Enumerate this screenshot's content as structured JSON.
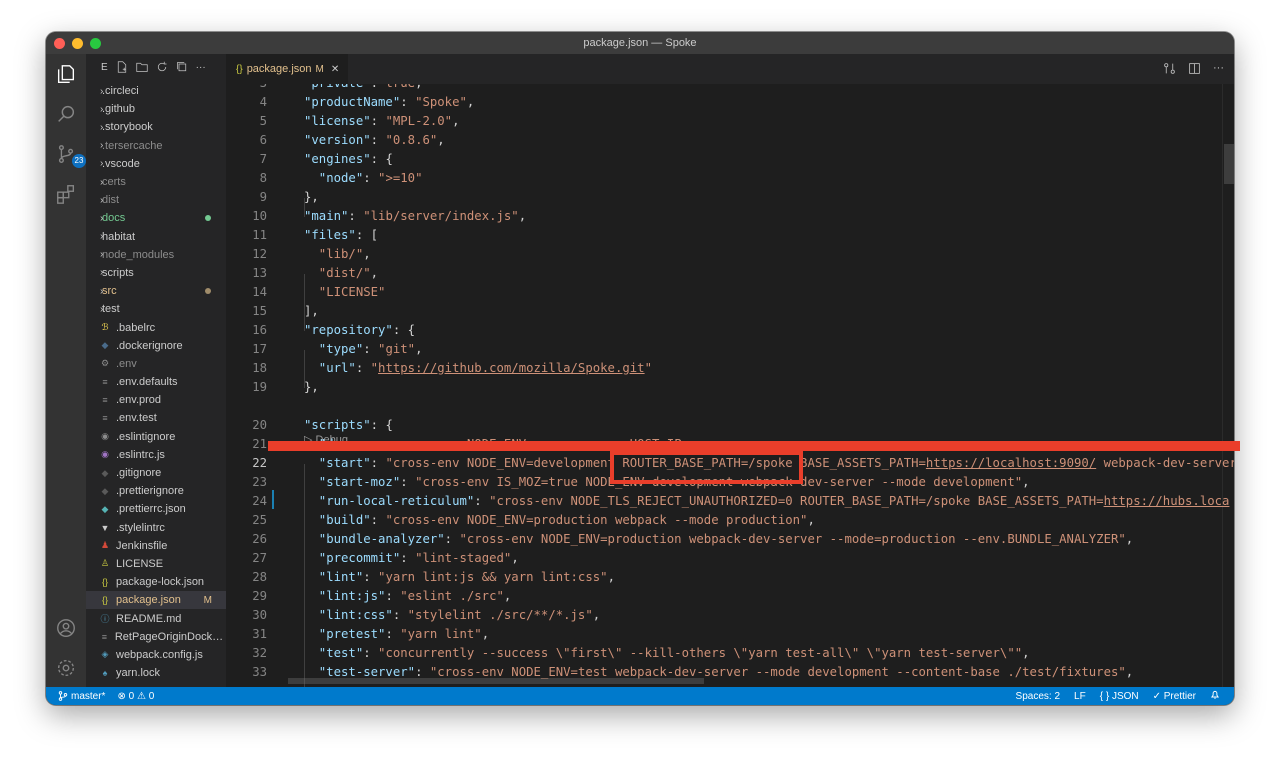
{
  "window": {
    "title": "package.json — Spoke"
  },
  "activity": {
    "scm_badge": "23"
  },
  "sidebar": {
    "header_letter": "E",
    "items": [
      {
        "label": ".circleci",
        "type": "folder",
        "color": "#cccccc"
      },
      {
        "label": ".github",
        "type": "folder",
        "color": "#cccccc"
      },
      {
        "label": ".storybook",
        "type": "folder",
        "color": "#cccccc"
      },
      {
        "label": ".tersercache",
        "type": "folder",
        "color": "#8c8c8c"
      },
      {
        "label": ".vscode",
        "type": "folder",
        "color": "#cccccc"
      },
      {
        "label": "certs",
        "type": "folder",
        "color": "#8c8c8c"
      },
      {
        "label": "dist",
        "type": "folder",
        "color": "#8c8c8c"
      },
      {
        "label": "docs",
        "type": "folder",
        "color": "#73c991",
        "dot": "#73c991"
      },
      {
        "label": "habitat",
        "type": "folder",
        "color": "#cccccc"
      },
      {
        "label": "node_modules",
        "type": "folder",
        "color": "#8c8c8c"
      },
      {
        "label": "scripts",
        "type": "folder",
        "color": "#cccccc"
      },
      {
        "label": "src",
        "type": "folder",
        "color": "#e2c08d",
        "dot": "#a08c6a"
      },
      {
        "label": "test",
        "type": "folder",
        "color": "#cccccc"
      },
      {
        "label": ".babelrc",
        "type": "file",
        "icon": "babel-icon",
        "icon_glyph": "ℬ",
        "icon_color": "#f5da55",
        "color": "#cccccc"
      },
      {
        "label": ".dockerignore",
        "type": "file",
        "icon": "docker-icon",
        "icon_glyph": "◆",
        "icon_color": "#4a6b8a",
        "color": "#cccccc"
      },
      {
        "label": ".env",
        "type": "file",
        "icon": "gear-icon",
        "icon_glyph": "⚙",
        "icon_color": "#8c8c8c",
        "color": "#8c8c8c"
      },
      {
        "label": ".env.defaults",
        "type": "file",
        "icon": "lines-icon",
        "icon_glyph": "≡",
        "icon_color": "#8c8c8c",
        "color": "#cccccc"
      },
      {
        "label": ".env.prod",
        "type": "file",
        "icon": "lines-icon",
        "icon_glyph": "≡",
        "icon_color": "#8c8c8c",
        "color": "#cccccc"
      },
      {
        "label": ".env.test",
        "type": "file",
        "icon": "lines-icon",
        "icon_glyph": "≡",
        "icon_color": "#8c8c8c",
        "color": "#cccccc"
      },
      {
        "label": ".eslintignore",
        "type": "file",
        "icon": "eslint-icon",
        "icon_glyph": "◉",
        "icon_color": "#8c8c8c",
        "color": "#cccccc"
      },
      {
        "label": ".eslintrc.js",
        "type": "file",
        "icon": "eslint-icon",
        "icon_glyph": "◉",
        "icon_color": "#a074c4",
        "color": "#cccccc"
      },
      {
        "label": ".gitignore",
        "type": "file",
        "icon": "git-icon",
        "icon_glyph": "◆",
        "icon_color": "#5a5a5a",
        "color": "#cccccc"
      },
      {
        "label": ".prettierignore",
        "type": "file",
        "icon": "prettier-icon",
        "icon_glyph": "◆",
        "icon_color": "#5a5a5a",
        "color": "#cccccc"
      },
      {
        "label": ".prettierrc.json",
        "type": "file",
        "icon": "prettier-icon",
        "icon_glyph": "◆",
        "icon_color": "#56b3b4",
        "color": "#cccccc"
      },
      {
        "label": ".stylelintrc",
        "type": "file",
        "icon": "stylelint-icon",
        "icon_glyph": "▼",
        "icon_color": "#cccccc",
        "color": "#cccccc"
      },
      {
        "label": "Jenkinsfile",
        "type": "file",
        "icon": "jenkins-icon",
        "icon_glyph": "♟",
        "icon_color": "#d24939",
        "color": "#cccccc"
      },
      {
        "label": "LICENSE",
        "type": "file",
        "icon": "license-icon",
        "icon_glyph": "♙",
        "icon_color": "#cbcb41",
        "color": "#cccccc"
      },
      {
        "label": "package-lock.json",
        "type": "file",
        "icon": "json-icon",
        "icon_glyph": "{}",
        "icon_color": "#cbcb41",
        "color": "#cccccc"
      },
      {
        "label": "package.json",
        "type": "file",
        "icon": "json-icon",
        "icon_glyph": "{}",
        "icon_color": "#cbcb41",
        "color": "#e2c08d",
        "selected": true,
        "mod": "M"
      },
      {
        "label": "README.md",
        "type": "file",
        "icon": "info-icon",
        "icon_glyph": "ⓘ",
        "icon_color": "#519aba",
        "color": "#cccccc"
      },
      {
        "label": "RetPageOriginDockerfile",
        "type": "file",
        "icon": "lines-icon",
        "icon_glyph": "≡",
        "icon_color": "#8c8c8c",
        "color": "#cccccc"
      },
      {
        "label": "webpack.config.js",
        "type": "file",
        "icon": "webpack-icon",
        "icon_glyph": "◈",
        "icon_color": "#519aba",
        "color": "#cccccc"
      },
      {
        "label": "yarn.lock",
        "type": "file",
        "icon": "yarn-icon",
        "icon_glyph": "♠",
        "icon_color": "#519aba",
        "color": "#cccccc"
      }
    ]
  },
  "tab": {
    "icon": "{}",
    "label": "package.json",
    "modified": "M",
    "close": "✕"
  },
  "codelens": "▷ Debug",
  "lines": [
    {
      "n": "3",
      "tokens": [
        {
          "t": "\"private\"",
          "c": "k"
        },
        {
          "t": ": ",
          "c": "p"
        },
        {
          "t": "true",
          "c": "s"
        },
        {
          "t": ",",
          "c": "p"
        }
      ]
    },
    {
      "n": "4",
      "tokens": [
        {
          "t": "\"productName\"",
          "c": "k"
        },
        {
          "t": ": ",
          "c": "p"
        },
        {
          "t": "\"Spoke\"",
          "c": "s"
        },
        {
          "t": ",",
          "c": "p"
        }
      ]
    },
    {
      "n": "5",
      "tokens": [
        {
          "t": "\"license\"",
          "c": "k"
        },
        {
          "t": ": ",
          "c": "p"
        },
        {
          "t": "\"MPL-2.0\"",
          "c": "s"
        },
        {
          "t": ",",
          "c": "p"
        }
      ]
    },
    {
      "n": "6",
      "tokens": [
        {
          "t": "\"version\"",
          "c": "k"
        },
        {
          "t": ": ",
          "c": "p"
        },
        {
          "t": "\"0.8.6\"",
          "c": "s"
        },
        {
          "t": ",",
          "c": "p"
        }
      ]
    },
    {
      "n": "7",
      "tokens": [
        {
          "t": "\"engines\"",
          "c": "k"
        },
        {
          "t": ": {",
          "c": "p"
        }
      ]
    },
    {
      "n": "8",
      "tokens": [
        {
          "t": "  \"node\"",
          "c": "k"
        },
        {
          "t": ": ",
          "c": "p"
        },
        {
          "t": "\">=10\"",
          "c": "s"
        }
      ]
    },
    {
      "n": "9",
      "tokens": [
        {
          "t": "},",
          "c": "p"
        }
      ]
    },
    {
      "n": "10",
      "tokens": [
        {
          "t": "\"main\"",
          "c": "k"
        },
        {
          "t": ": ",
          "c": "p"
        },
        {
          "t": "\"lib/server/index.js\"",
          "c": "s"
        },
        {
          "t": ",",
          "c": "p"
        }
      ]
    },
    {
      "n": "11",
      "tokens": [
        {
          "t": "\"files\"",
          "c": "k"
        },
        {
          "t": ": [",
          "c": "p"
        }
      ]
    },
    {
      "n": "12",
      "tokens": [
        {
          "t": "  \"lib/\"",
          "c": "s"
        },
        {
          "t": ",",
          "c": "p"
        }
      ]
    },
    {
      "n": "13",
      "tokens": [
        {
          "t": "  \"dist/\"",
          "c": "s"
        },
        {
          "t": ",",
          "c": "p"
        }
      ]
    },
    {
      "n": "14",
      "tokens": [
        {
          "t": "  \"LICENSE\"",
          "c": "s"
        }
      ]
    },
    {
      "n": "15",
      "tokens": [
        {
          "t": "],",
          "c": "p"
        }
      ]
    },
    {
      "n": "16",
      "tokens": [
        {
          "t": "\"repository\"",
          "c": "k"
        },
        {
          "t": ": {",
          "c": "p"
        }
      ]
    },
    {
      "n": "17",
      "tokens": [
        {
          "t": "  \"type\"",
          "c": "k"
        },
        {
          "t": ": ",
          "c": "p"
        },
        {
          "t": "\"git\"",
          "c": "s"
        },
        {
          "t": ",",
          "c": "p"
        }
      ]
    },
    {
      "n": "18",
      "tokens": [
        {
          "t": "  \"url\"",
          "c": "k"
        },
        {
          "t": ": ",
          "c": "p"
        },
        {
          "t": "\"",
          "c": "s"
        },
        {
          "t": "https://github.com/mozilla/Spoke.git",
          "c": "u"
        },
        {
          "t": "\"",
          "c": "s"
        }
      ]
    },
    {
      "n": "19",
      "tokens": [
        {
          "t": "},",
          "c": "p"
        }
      ]
    },
    {
      "n": "20",
      "tokens": [
        {
          "t": "\"scripts\"",
          "c": "k"
        },
        {
          "t": ": {",
          "c": "p"
        }
      ]
    },
    {
      "n": "21",
      "tokens": [
        {
          "t": "  \"d",
          "c": "k"
        },
        {
          "t": "   ",
          "c": "p"
        },
        {
          "t": "               NODE_ENV=             HOST_IP=           ",
          "c": "s"
        }
      ]
    },
    {
      "n": "22",
      "current": true,
      "tokens": [
        {
          "t": "  \"start\"",
          "c": "k"
        },
        {
          "t": ": ",
          "c": "p"
        },
        {
          "t": "\"cross-env NODE_ENV=development ROUTER_BASE_PATH=/spoke BASE_ASSETS_PATH=",
          "c": "s"
        },
        {
          "t": "https://localhost:9090/",
          "c": "u"
        },
        {
          "t": " webpack-dev-server",
          "c": "s"
        }
      ]
    },
    {
      "n": "23",
      "tokens": [
        {
          "t": "  \"start-moz\"",
          "c": "k"
        },
        {
          "t": ": ",
          "c": "p"
        },
        {
          "t": "\"cross-env IS_MOZ=true NODE_ENV=development webpack-dev-server --mode development\"",
          "c": "s"
        },
        {
          "t": ",",
          "c": "p"
        }
      ]
    },
    {
      "n": "24",
      "tokens": [
        {
          "t": "  \"run-local-reticulum\"",
          "c": "k"
        },
        {
          "t": ": ",
          "c": "p"
        },
        {
          "t": "\"cross-env NODE_TLS_REJECT_UNAUTHORIZED=0 ROUTER_BASE_PATH=/spoke BASE_ASSETS_PATH=",
          "c": "s"
        },
        {
          "t": "https://hubs.loca",
          "c": "u"
        }
      ]
    },
    {
      "n": "25",
      "tokens": [
        {
          "t": "  \"build\"",
          "c": "k"
        },
        {
          "t": ": ",
          "c": "p"
        },
        {
          "t": "\"cross-env NODE_ENV=production webpack --mode production\"",
          "c": "s"
        },
        {
          "t": ",",
          "c": "p"
        }
      ]
    },
    {
      "n": "26",
      "tokens": [
        {
          "t": "  \"bundle-analyzer\"",
          "c": "k"
        },
        {
          "t": ": ",
          "c": "p"
        },
        {
          "t": "\"cross-env NODE_ENV=production webpack-dev-server --mode=production --env.BUNDLE_ANALYZER\"",
          "c": "s"
        },
        {
          "t": ",",
          "c": "p"
        }
      ]
    },
    {
      "n": "27",
      "tokens": [
        {
          "t": "  \"precommit\"",
          "c": "k"
        },
        {
          "t": ": ",
          "c": "p"
        },
        {
          "t": "\"lint-staged\"",
          "c": "s"
        },
        {
          "t": ",",
          "c": "p"
        }
      ]
    },
    {
      "n": "28",
      "tokens": [
        {
          "t": "  \"lint\"",
          "c": "k"
        },
        {
          "t": ": ",
          "c": "p"
        },
        {
          "t": "\"yarn lint:js && yarn lint:css\"",
          "c": "s"
        },
        {
          "t": ",",
          "c": "p"
        }
      ]
    },
    {
      "n": "29",
      "tokens": [
        {
          "t": "  \"lint:js\"",
          "c": "k"
        },
        {
          "t": ": ",
          "c": "p"
        },
        {
          "t": "\"eslint ./src\"",
          "c": "s"
        },
        {
          "t": ",",
          "c": "p"
        }
      ]
    },
    {
      "n": "30",
      "tokens": [
        {
          "t": "  \"lint:css\"",
          "c": "k"
        },
        {
          "t": ": ",
          "c": "p"
        },
        {
          "t": "\"stylelint ./src/**/*.js\"",
          "c": "s"
        },
        {
          "t": ",",
          "c": "p"
        }
      ]
    },
    {
      "n": "31",
      "tokens": [
        {
          "t": "  \"pretest\"",
          "c": "k"
        },
        {
          "t": ": ",
          "c": "p"
        },
        {
          "t": "\"yarn lint\"",
          "c": "s"
        },
        {
          "t": ",",
          "c": "p"
        }
      ]
    },
    {
      "n": "32",
      "tokens": [
        {
          "t": "  \"test\"",
          "c": "k"
        },
        {
          "t": ": ",
          "c": "p"
        },
        {
          "t": "\"concurrently --success \\\"first\\\" --kill-others \\\"yarn test-all\\\" \\\"yarn test-server\\\"\"",
          "c": "s"
        },
        {
          "t": ",",
          "c": "p"
        }
      ]
    },
    {
      "n": "33",
      "tokens": [
        {
          "t": "  \"test-server\"",
          "c": "k"
        },
        {
          "t": ": ",
          "c": "p"
        },
        {
          "t": "\"cross-env NODE_ENV=test webpack-dev-server --mode development --content-base ./test/fixtures\"",
          "c": "s"
        },
        {
          "t": ",",
          "c": "p"
        }
      ]
    }
  ],
  "status": {
    "branch": "master*",
    "problems": "⊗ 0 ⚠ 0",
    "spaces": "Spaces: 2",
    "eol": "LF",
    "language": "{ } JSON",
    "prettier": "✓ Prettier"
  }
}
